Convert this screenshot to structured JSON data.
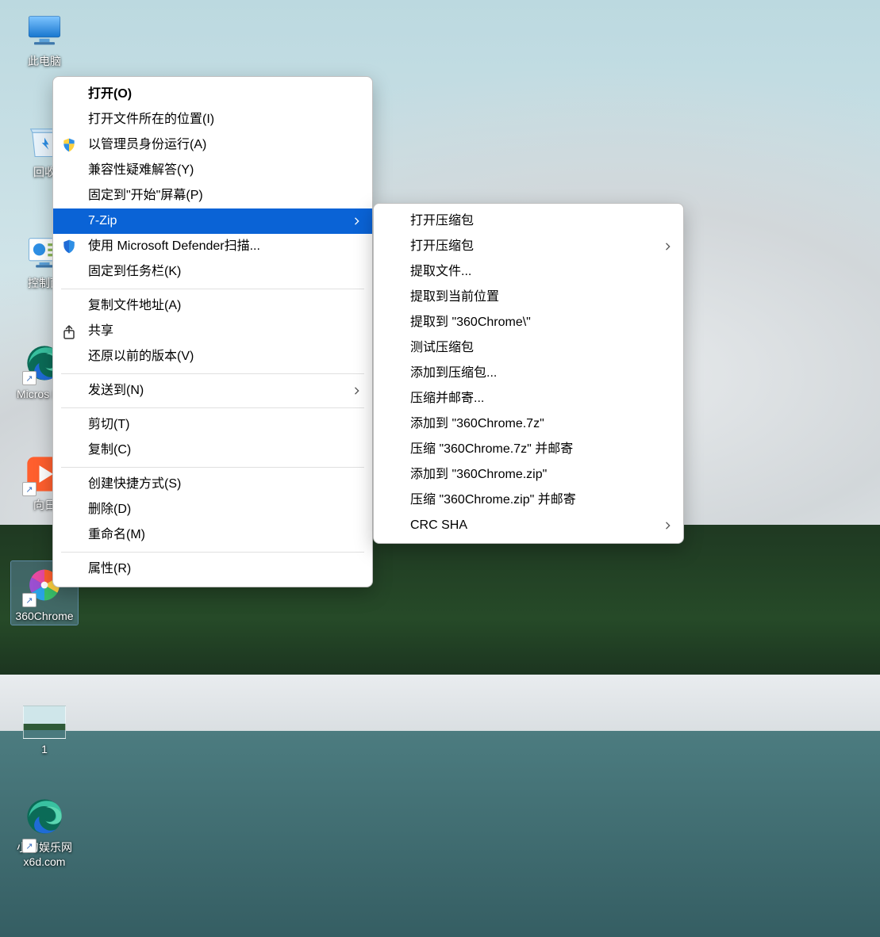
{
  "desktop": {
    "icons": [
      {
        "id": "this-pc",
        "label": "此电脑",
        "kind": "pc",
        "shortcut": false,
        "selected": false
      },
      {
        "id": "recycle-bin",
        "label": "回收",
        "kind": "recycle",
        "shortcut": false,
        "selected": false
      },
      {
        "id": "control-panel",
        "label": "控制面",
        "kind": "control",
        "shortcut": false,
        "selected": false
      },
      {
        "id": "edge",
        "label": "Micros Edg",
        "kind": "edge",
        "shortcut": true,
        "selected": false
      },
      {
        "id": "sunflower",
        "label": "向日",
        "kind": "sun",
        "shortcut": true,
        "selected": false
      },
      {
        "id": "360chrome",
        "label": "360Chrome",
        "kind": "pinwheel",
        "shortcut": true,
        "selected": true
      },
      {
        "id": "screenshot",
        "label": "1",
        "kind": "thumb",
        "shortcut": false,
        "selected": false
      },
      {
        "id": "edge2",
        "label": "小刀娱乐网 x6d.com",
        "kind": "edge",
        "shortcut": true,
        "selected": false
      }
    ]
  },
  "contextMenu": {
    "items": [
      {
        "label": "打开(O)",
        "bold": true
      },
      {
        "label": "打开文件所在的位置(I)"
      },
      {
        "label": "以管理员身份运行(A)",
        "icon": "shield-uac"
      },
      {
        "label": "兼容性疑难解答(Y)"
      },
      {
        "label": "固定到\"开始\"屏幕(P)"
      },
      {
        "label": "7-Zip",
        "submenu": true,
        "highlight": true
      },
      {
        "label": "使用 Microsoft Defender扫描...",
        "icon": "shield-defender"
      },
      {
        "label": "固定到任务栏(K)"
      },
      {
        "sep": true
      },
      {
        "label": "复制文件地址(A)"
      },
      {
        "label": "共享",
        "icon": "share"
      },
      {
        "label": "还原以前的版本(V)"
      },
      {
        "sep": true
      },
      {
        "label": "发送到(N)",
        "submenu": true
      },
      {
        "sep": true
      },
      {
        "label": "剪切(T)"
      },
      {
        "label": "复制(C)"
      },
      {
        "sep": true
      },
      {
        "label": "创建快捷方式(S)"
      },
      {
        "label": "删除(D)"
      },
      {
        "label": "重命名(M)"
      },
      {
        "sep": true
      },
      {
        "label": "属性(R)"
      }
    ]
  },
  "submenu": {
    "items": [
      {
        "label": "打开压缩包"
      },
      {
        "label": "打开压缩包",
        "submenu": true
      },
      {
        "label": "提取文件..."
      },
      {
        "label": "提取到当前位置"
      },
      {
        "label": "提取到 \"360Chrome\\\""
      },
      {
        "label": "测试压缩包"
      },
      {
        "label": "添加到压缩包..."
      },
      {
        "label": "压缩并邮寄..."
      },
      {
        "label": "添加到 \"360Chrome.7z\""
      },
      {
        "label": "压缩 \"360Chrome.7z\" 并邮寄"
      },
      {
        "label": "添加到 \"360Chrome.zip\""
      },
      {
        "label": "压缩 \"360Chrome.zip\" 并邮寄"
      },
      {
        "label": "CRC SHA",
        "submenu": true
      }
    ]
  }
}
